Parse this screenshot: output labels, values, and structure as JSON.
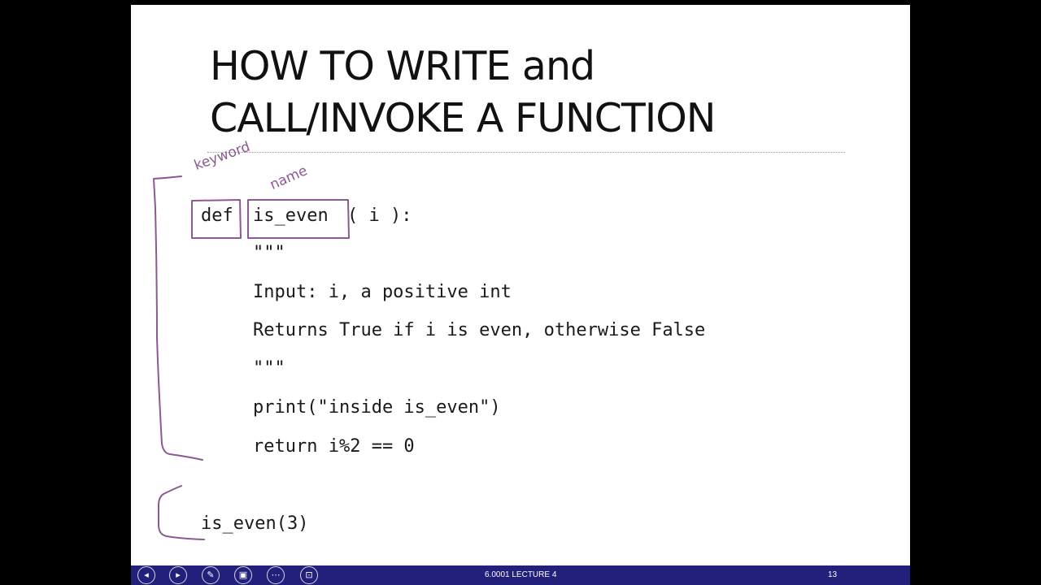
{
  "slide": {
    "title_line1": "HOW TO WRITE and",
    "title_line2": "CALL/INVOKE A FUNCTION",
    "annotations": {
      "keyword_label": "keyword",
      "name_label": "name",
      "ink_color": "#8a5a90"
    },
    "code": {
      "def_keyword": "def",
      "func_name": "is_even",
      "signature_rest": "( i ):",
      "docstring_open": "\"\"\"",
      "doc_line1": "Input: i, a positive int",
      "doc_line2": "Returns True if i is even, otherwise False",
      "docstring_close": "\"\"\"",
      "print_line": "print(\"inside is_even\")",
      "return_line": "return i%2 == 0",
      "call_line": "is_even(3)"
    }
  },
  "taskbar": {
    "background": "#23207c",
    "buttons": [
      {
        "name": "previous-slide-button",
        "icon": "chevron-left-icon",
        "glyph": "◂"
      },
      {
        "name": "next-slide-button",
        "icon": "chevron-right-icon",
        "glyph": "▸"
      },
      {
        "name": "pen-tool-button",
        "icon": "pen-icon",
        "glyph": "✎"
      },
      {
        "name": "slide-sorter-button",
        "icon": "slides-icon",
        "glyph": "▣"
      },
      {
        "name": "more-options-button",
        "icon": "ellipsis-icon",
        "glyph": "⋯"
      },
      {
        "name": "zoom-button",
        "icon": "magnify-icon",
        "glyph": "⊡"
      }
    ],
    "footer_text": "6.0001 LECTURE 4",
    "slide_number": "13"
  }
}
